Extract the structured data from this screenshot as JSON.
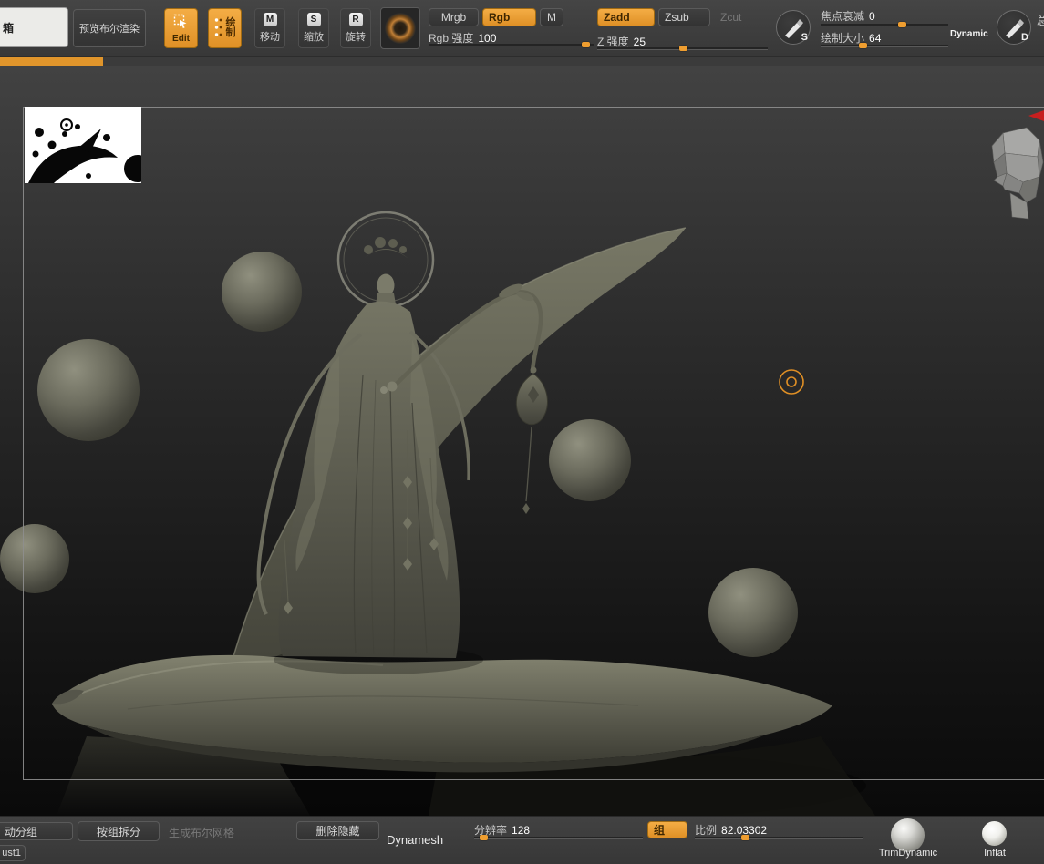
{
  "toolbar": {
    "lightbox_label": "箱",
    "preview_boolean_label": "预览布尔渲染",
    "edit_label": "Edit",
    "draw_char_top": "绘",
    "draw_char_bottom": "制",
    "move_icon": "M",
    "move_label": "移动",
    "scale_icon": "S",
    "scale_label": "缩放",
    "rotate_icon": "R",
    "rotate_label": "旋转",
    "mrgb_label": "Mrgb",
    "rgb_label": "Rgb",
    "m_label": "M",
    "rgb_intensity_label": "Rgb 强度",
    "rgb_intensity_value": "100",
    "zadd_label": "Zadd",
    "zsub_label": "Zsub",
    "zcut_label": "Zcut",
    "z_intensity_label": "Z 强度",
    "z_intensity_value": "25",
    "stroke_icon_letter": "S",
    "focal_shift_label": "焦点衰减",
    "focal_shift_value": "0",
    "draw_size_label": "绘制大小",
    "draw_size_value": "64",
    "dynamic_label": "Dynamic",
    "depth_icon_letter": "D",
    "right_clipped_label": "总"
  },
  "bottombar": {
    "autogroup_label": "动分组",
    "brush_name_clipped": "ust1",
    "split_by_group_label": "按组拆分",
    "generate_boolean_label": "生成布尔网格",
    "delete_hidden_label": "删除隐藏",
    "dynamesh_label": "Dynamesh",
    "resolution_label": "分辨率",
    "resolution_value": "128",
    "group_label": "组",
    "ratio_label": "比例",
    "ratio_value": "82.03302",
    "brush_trim_label": "TrimDynamic",
    "brush_inflat_label": "Inflat"
  },
  "colors": {
    "accent_orange": "#ef9e30",
    "progress_orange": "#e0952b",
    "clay_olive": "#6b6b5d",
    "canvas_dark": "#141414"
  }
}
